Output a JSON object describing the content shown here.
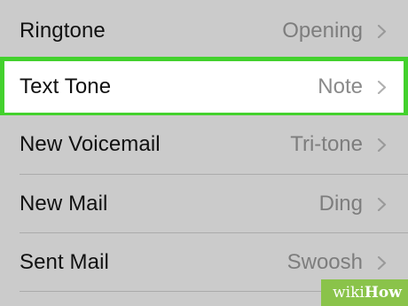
{
  "settings_list": {
    "items": [
      {
        "label": "Ringtone",
        "value": "Opening",
        "highlighted": false
      },
      {
        "label": "Text Tone",
        "value": "Note",
        "highlighted": true
      },
      {
        "label": "New Voicemail",
        "value": "Tri-tone",
        "highlighted": false
      },
      {
        "label": "New Mail",
        "value": "Ding",
        "highlighted": false
      },
      {
        "label": "Sent Mail",
        "value": "Swoosh",
        "highlighted": false
      }
    ]
  },
  "colors": {
    "background": "#cbcbcb",
    "highlight_border": "#43d12d",
    "highlight_fill": "#ffffff",
    "value_text": "#7d7d7d",
    "label_text": "#111111",
    "watermark_bg": "#8ac34a"
  },
  "icons": {
    "disclosure": "chevron-right-icon"
  },
  "watermark": {
    "prefix": "wiki",
    "suffix": "How"
  }
}
